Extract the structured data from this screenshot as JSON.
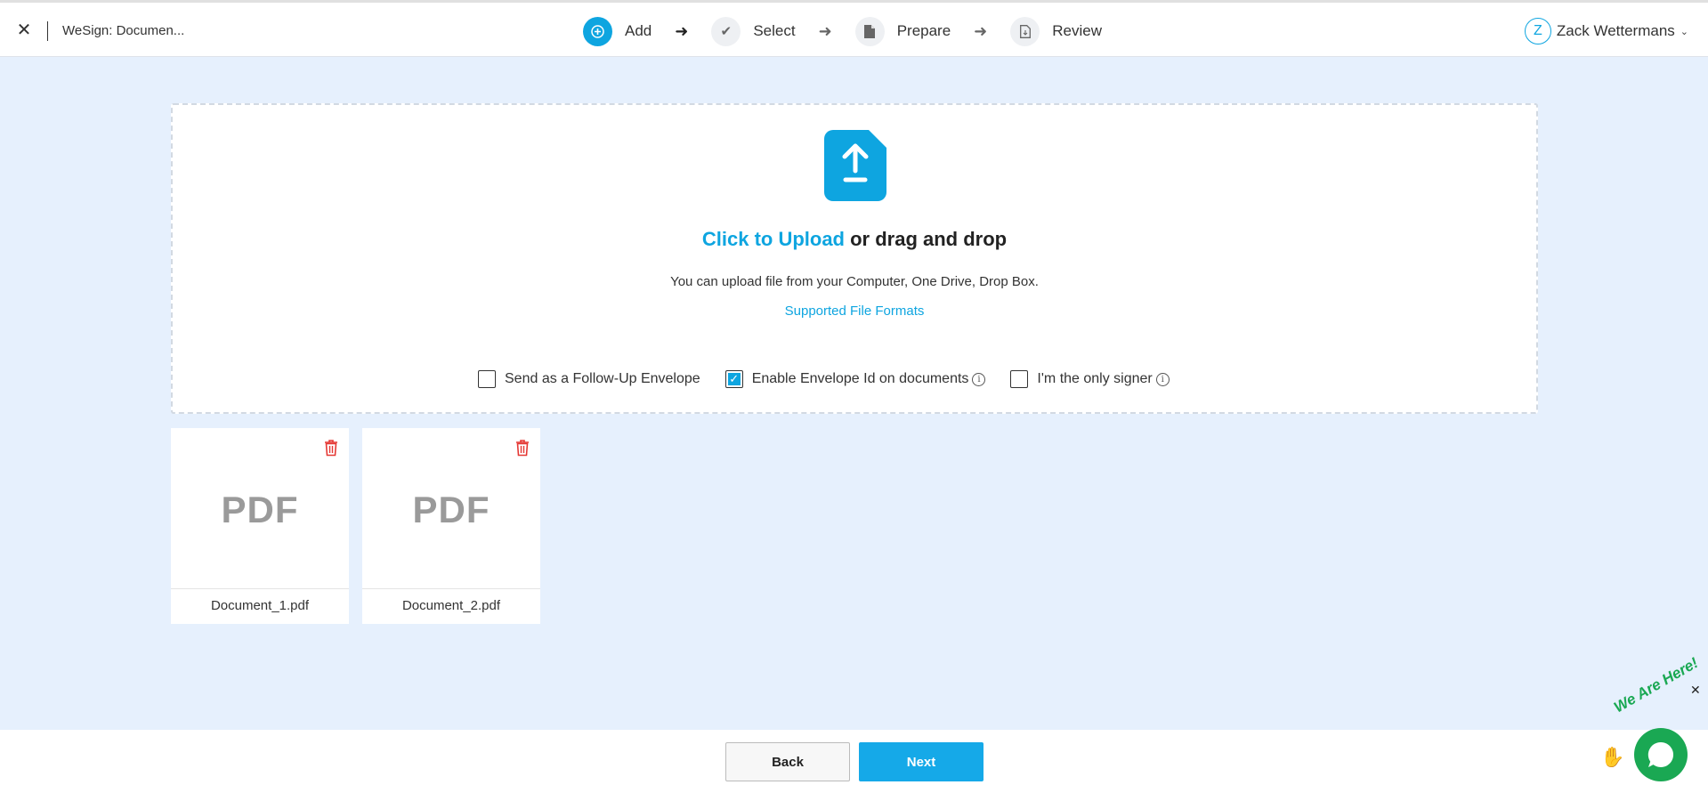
{
  "header": {
    "close_symbol": "✕",
    "doc_title": "WeSign: Documen...",
    "steps": [
      {
        "label": "Add",
        "icon": "plus-circle-icon",
        "active": true
      },
      {
        "label": "Select",
        "icon": "check-icon",
        "active": false
      },
      {
        "label": "Prepare",
        "icon": "document-icon",
        "active": false
      },
      {
        "label": "Review",
        "icon": "document-review-icon",
        "active": false
      }
    ],
    "user": {
      "initial": "Z",
      "name": "Zack Wettermans"
    }
  },
  "upload": {
    "link_text": "Click to Upload",
    "rest_text": " or drag and drop",
    "subtitle": "You can upload file from your Computer, One Drive, Drop Box.",
    "formats_link": "Supported File Formats",
    "options": [
      {
        "label": "Send as a Follow-Up Envelope",
        "checked": false,
        "info": false
      },
      {
        "label": "Enable Envelope Id on documents",
        "checked": true,
        "info": true
      },
      {
        "label": "I'm the only signer",
        "checked": false,
        "info": true
      }
    ]
  },
  "files": [
    {
      "type_label": "PDF",
      "name": "Document_1.pdf"
    },
    {
      "type_label": "PDF",
      "name": "Document_2.pdf"
    }
  ],
  "footer": {
    "back_label": "Back",
    "next_label": "Next"
  },
  "chat": {
    "badge_text": "We Are Here!",
    "close_symbol": "✕"
  },
  "colors": {
    "accent": "#0ea5e0",
    "background": "#e6f0fd",
    "trash": "#e53935",
    "chat": "#1aa853"
  }
}
